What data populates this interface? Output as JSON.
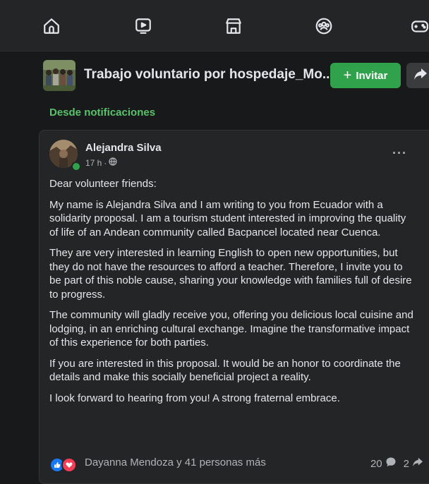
{
  "nav": {
    "icons": [
      "home-icon",
      "watch-icon",
      "marketplace-icon",
      "groups-icon",
      "gaming-icon"
    ]
  },
  "group": {
    "name": "Trabajo voluntario por hospedaje_Mo...",
    "invite_label": "Invitar",
    "invite_symbol": "+"
  },
  "notification_label": "Desde notificaciones",
  "post": {
    "author": "Alejandra Silva",
    "time": "17 h",
    "separator": "·",
    "paragraphs": [
      "Dear volunteer friends:",
      "My name is Alejandra Silva and I am writing to you from Ecuador with a solidarity proposal. I am a tourism student interested in improving the quality of life of an Andean community called Bacpancel located near Cuenca.",
      "They are very interested in learning English to open new opportunities, but they do not have the resources to afford a teacher. Therefore, I invite you to be part of this noble cause, sharing your knowledge with families full of desire to progress.",
      "The community will gladly receive you, offering you delicious local cuisine and lodging, in an enriching cultural exchange. Imagine the transformative impact of this experience for both parties.",
      "If you are interested in this proposal. It would be an honor to coordinate the details and make this socially beneficial project a reality.",
      "I look forward to hearing from you! A strong fraternal embrace."
    ],
    "more_label": "···"
  },
  "footer": {
    "reactions_text": "Dayanna Mendoza y 41 personas más",
    "comments_count": "20",
    "shares_count": "2"
  },
  "colors": {
    "accent_green": "#31a24c",
    "like_blue": "#1877f2",
    "love_red": "#f33e58"
  }
}
